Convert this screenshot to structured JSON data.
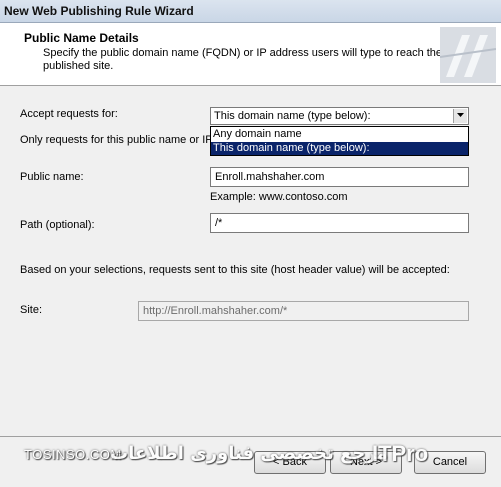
{
  "window": {
    "title": "New Web Publishing Rule Wizard"
  },
  "header": {
    "title": "Public Name Details",
    "description": "Specify the public domain name (FQDN) or IP address users will type to reach the published site."
  },
  "form": {
    "accept_label": "Accept requests for:",
    "accept_selected": "This domain name (type below):",
    "accept_options": [
      "Any domain name",
      "This domain name (type below):"
    ],
    "only_requests_text": "Only requests for this public name or IP",
    "public_name_label": "Public name:",
    "public_name_value": "Enroll.mahshaher.com",
    "example_text": "Example: www.contoso.com",
    "path_label": "Path (optional):",
    "path_value": "/*",
    "based_text": "Based on your selections, requests sent to this site (host header value) will be accepted:",
    "site_label": "Site:",
    "site_value": "http://Enroll.mahshaher.com/*"
  },
  "buttons": {
    "back": "< Back",
    "next": "Next >",
    "cancel": "Cancel"
  },
  "watermark": {
    "left": "TOSINSO.COM",
    "middle": "مرجع تخصصی فناوری اطلاعات",
    "right": "ITPro"
  }
}
